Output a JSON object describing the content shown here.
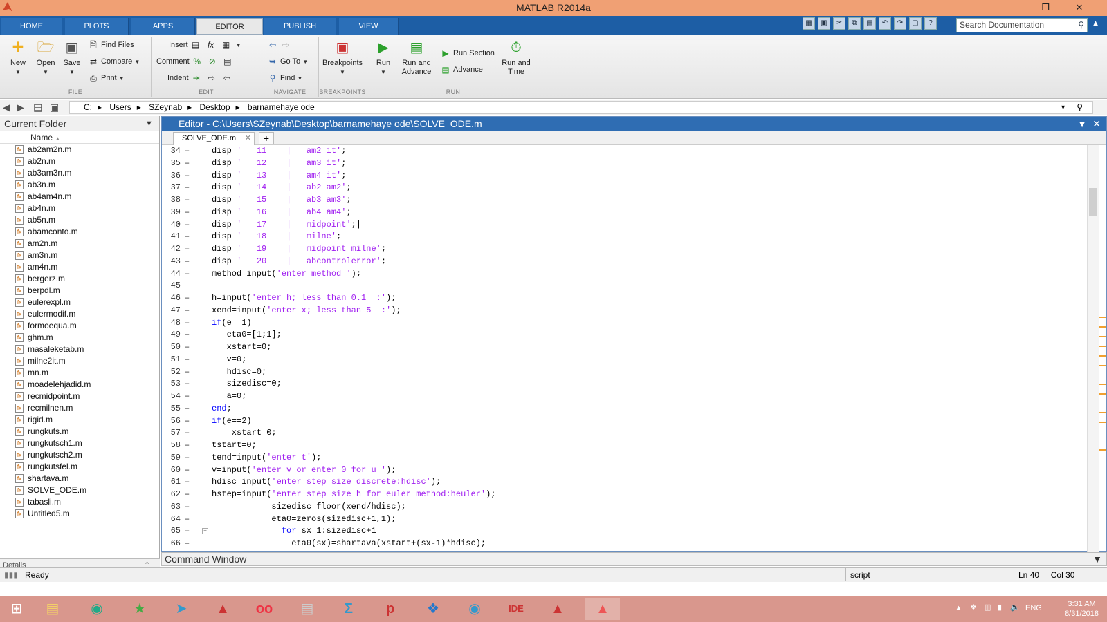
{
  "window": {
    "title": "MATLAB R2014a"
  },
  "ribbon_tabs": [
    "HOME",
    "PLOTS",
    "APPS",
    "EDITOR",
    "PUBLISH",
    "VIEW"
  ],
  "search": {
    "placeholder": "Search Documentation"
  },
  "ribbon": {
    "file": {
      "new": "New",
      "open": "Open",
      "save": "Save",
      "find_files": "Find Files",
      "compare": "Compare",
      "print": "Print",
      "label": "FILE"
    },
    "edit": {
      "insert": "Insert",
      "comment": "Comment",
      "indent": "Indent",
      "label": "EDIT"
    },
    "navigate": {
      "go_to": "Go To",
      "find": "Find",
      "label": "NAVIGATE"
    },
    "breakpoints": {
      "breakpoints": "Breakpoints",
      "label": "BREAKPOINTS"
    },
    "run": {
      "run": "Run",
      "run_advance": "Run and\nAdvance",
      "run_section": "Run Section",
      "advance": "Advance",
      "run_time": "Run and\nTime",
      "label": "RUN"
    }
  },
  "address": {
    "crumbs": [
      "C:",
      "Users",
      "SZeynab",
      "Desktop",
      "barnamehaye ode"
    ]
  },
  "current_folder": {
    "title": "Current Folder",
    "column": "Name",
    "files": [
      "ab2am2n.m",
      "ab2n.m",
      "ab3am3n.m",
      "ab3n.m",
      "ab4am4n.m",
      "ab4n.m",
      "ab5n.m",
      "abamconto.m",
      "am2n.m",
      "am3n.m",
      "am4n.m",
      "bergerz.m",
      "berpdl.m",
      "eulerexpl.m",
      "eulermodif.m",
      "formoequa.m",
      "ghm.m",
      "masaleketab.m",
      "milne2it.m",
      "mn.m",
      "moadelehjadid.m",
      "recmidpoint.m",
      "recmilnen.m",
      "rigid.m",
      "rungkuts.m",
      "rungkutsch1.m",
      "rungkutsch2.m",
      "rungkutsfel.m",
      "shartava.m",
      "SOLVE_ODE.m",
      "tabasli.m",
      "Untitled5.m"
    ],
    "details": "Details"
  },
  "editor": {
    "title": "Editor - C:\\Users\\SZeynab\\Desktop\\barnamehaye ode\\SOLVE_ODE.m",
    "tab": "SOLVE_ODE.m",
    "lines": [
      {
        "n": "34",
        "d": "–",
        "t": [
          [
            "n",
            "disp "
          ],
          [
            "s",
            "'   11    |   am2 it'"
          ],
          [
            "n",
            ";"
          ]
        ]
      },
      {
        "n": "35",
        "d": "–",
        "t": [
          [
            "n",
            "disp "
          ],
          [
            "s",
            "'   12    |   am3 it'"
          ],
          [
            "n",
            ";"
          ]
        ]
      },
      {
        "n": "36",
        "d": "–",
        "t": [
          [
            "n",
            "disp "
          ],
          [
            "s",
            "'   13    |   am4 it'"
          ],
          [
            "n",
            ";"
          ]
        ]
      },
      {
        "n": "37",
        "d": "–",
        "t": [
          [
            "n",
            "disp "
          ],
          [
            "s",
            "'   14    |   ab2 am2'"
          ],
          [
            "n",
            ";"
          ]
        ]
      },
      {
        "n": "38",
        "d": "–",
        "t": [
          [
            "n",
            "disp "
          ],
          [
            "s",
            "'   15    |   ab3 am3'"
          ],
          [
            "n",
            ";"
          ]
        ]
      },
      {
        "n": "39",
        "d": "–",
        "t": [
          [
            "n",
            "disp "
          ],
          [
            "s",
            "'   16    |   ab4 am4'"
          ],
          [
            "n",
            ";"
          ]
        ]
      },
      {
        "n": "40",
        "d": "–",
        "t": [
          [
            "n",
            "disp "
          ],
          [
            "s",
            "'   17    |   midpoint'"
          ],
          [
            "n",
            ";|"
          ]
        ]
      },
      {
        "n": "41",
        "d": "–",
        "t": [
          [
            "n",
            "disp "
          ],
          [
            "s",
            "'   18    |   milne'"
          ],
          [
            "n",
            ";"
          ]
        ]
      },
      {
        "n": "42",
        "d": "–",
        "t": [
          [
            "n",
            "disp "
          ],
          [
            "s",
            "'   19    |   midpoint milne'"
          ],
          [
            "n",
            ";"
          ]
        ]
      },
      {
        "n": "43",
        "d": "–",
        "t": [
          [
            "n",
            "disp "
          ],
          [
            "s",
            "'   20    |   abcontrolerror'"
          ],
          [
            "n",
            ";"
          ]
        ]
      },
      {
        "n": "44",
        "d": "–",
        "t": [
          [
            "n",
            "method=input("
          ],
          [
            "s",
            "'enter method '"
          ],
          [
            "n",
            ");"
          ]
        ]
      },
      {
        "n": "45",
        "d": "",
        "t": []
      },
      {
        "n": "46",
        "d": "–",
        "t": [
          [
            "n",
            "h=input("
          ],
          [
            "s",
            "'enter h; less than 0.1  :'"
          ],
          [
            "n",
            ");"
          ]
        ]
      },
      {
        "n": "47",
        "d": "–",
        "t": [
          [
            "n",
            "xend=input("
          ],
          [
            "s",
            "'enter x; less than 5  :'"
          ],
          [
            "n",
            ");"
          ]
        ]
      },
      {
        "n": "48",
        "d": "–",
        "t": [
          [
            "k",
            "if"
          ],
          [
            "n",
            "(e==1)"
          ]
        ]
      },
      {
        "n": "49",
        "d": "–",
        "t": [
          [
            "n",
            "   eta0=[1;1];"
          ]
        ]
      },
      {
        "n": "50",
        "d": "–",
        "t": [
          [
            "n",
            "   xstart=0;"
          ]
        ]
      },
      {
        "n": "51",
        "d": "–",
        "t": [
          [
            "n",
            "   v=0;"
          ]
        ]
      },
      {
        "n": "52",
        "d": "–",
        "t": [
          [
            "n",
            "   hdisc=0;"
          ]
        ]
      },
      {
        "n": "53",
        "d": "–",
        "t": [
          [
            "n",
            "   sizedisc=0;"
          ]
        ]
      },
      {
        "n": "54",
        "d": "–",
        "t": [
          [
            "n",
            "   a=0;"
          ]
        ]
      },
      {
        "n": "55",
        "d": "–",
        "t": [
          [
            "k",
            "end"
          ],
          [
            "n",
            ";"
          ]
        ]
      },
      {
        "n": "56",
        "d": "–",
        "t": [
          [
            "k",
            "if"
          ],
          [
            "n",
            "(e==2)"
          ]
        ]
      },
      {
        "n": "57",
        "d": "–",
        "t": [
          [
            "n",
            "    xstart=0;"
          ]
        ]
      },
      {
        "n": "58",
        "d": "–",
        "t": [
          [
            "n",
            "tstart=0;"
          ]
        ]
      },
      {
        "n": "59",
        "d": "–",
        "t": [
          [
            "n",
            "tend=input("
          ],
          [
            "s",
            "'enter t'"
          ],
          [
            "n",
            ");"
          ]
        ]
      },
      {
        "n": "60",
        "d": "–",
        "t": [
          [
            "n",
            "v=input("
          ],
          [
            "s",
            "'enter v or enter 0 for u '"
          ],
          [
            "n",
            ");"
          ]
        ]
      },
      {
        "n": "61",
        "d": "–",
        "t": [
          [
            "n",
            "hdisc=input("
          ],
          [
            "s",
            "'enter step size discrete:hdisc'"
          ],
          [
            "n",
            ");"
          ]
        ]
      },
      {
        "n": "62",
        "d": "–",
        "t": [
          [
            "n",
            "hstep=input("
          ],
          [
            "s",
            "'enter step size h for euler method:heuler'"
          ],
          [
            "n",
            ");"
          ]
        ]
      },
      {
        "n": "63",
        "d": "–",
        "t": [
          [
            "n",
            "            sizedisc=floor(xend/hdisc);"
          ]
        ]
      },
      {
        "n": "64",
        "d": "–",
        "t": [
          [
            "n",
            "            eta0=zeros(sizedisc+1,1);"
          ]
        ]
      },
      {
        "n": "65",
        "d": "–",
        "f": "−",
        "t": [
          [
            "n",
            "              "
          ],
          [
            "k",
            "for"
          ],
          [
            "n",
            " sx=1:sizedisc+1"
          ]
        ]
      },
      {
        "n": "66",
        "d": "–",
        "t": [
          [
            "n",
            "                eta0(sx)=shartava(xstart+(sx-1)*hdisc);"
          ]
        ]
      }
    ]
  },
  "command_window": "Command Window",
  "status": {
    "ready": "Ready",
    "mode": "script",
    "ln_label": "Ln",
    "ln": "40",
    "col_label": "Col",
    "col": "30"
  },
  "taskbar": {
    "lang": "ENG",
    "time": "3:31 AM",
    "date": "8/31/2018"
  }
}
